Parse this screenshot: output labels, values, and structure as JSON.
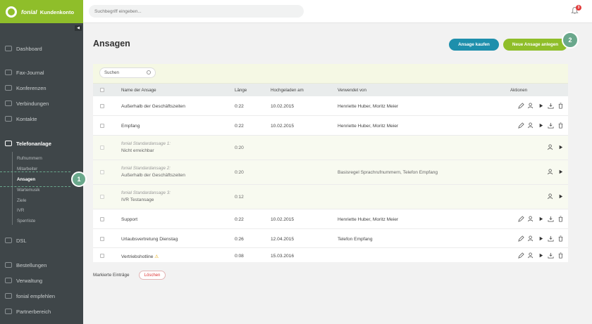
{
  "brand": {
    "name": "fonial",
    "suffix": "Kundenkonto"
  },
  "topbar": {
    "search_placeholder": "Suchbegriff eingeben...",
    "notifications_count": "3"
  },
  "sidebar": {
    "collapse_glyph": "◀",
    "items": [
      {
        "label": "Dashboard"
      },
      {
        "label": "Fax-Journal"
      },
      {
        "label": "Konferenzen"
      },
      {
        "label": "Verbindungen"
      },
      {
        "label": "Kontakte"
      },
      {
        "label": "Telefonanlage"
      },
      {
        "label": "DSL"
      },
      {
        "label": "Bestellungen"
      },
      {
        "label": "Verwaltung"
      },
      {
        "label": "fonial empfehlen"
      },
      {
        "label": "Partnerbereich"
      }
    ],
    "sub_items": [
      {
        "label": "Rufnummern"
      },
      {
        "label": "Mitarbeiter"
      },
      {
        "label": "Ansagen"
      },
      {
        "label": "Wartemusik"
      },
      {
        "label": "Ziele"
      },
      {
        "label": "IVR"
      },
      {
        "label": "Sperrliste"
      }
    ]
  },
  "main": {
    "title": "Ansagen",
    "buttons": {
      "buy": "Ansage kaufen",
      "new": "Neue Ansage anlegen"
    },
    "search_label": "Suchen",
    "columns": {
      "name": "Name der Ansage",
      "length": "Länge",
      "uploaded": "Hochgeladen am",
      "used_by": "Verwendet von",
      "actions": "Aktionen"
    },
    "rows": [
      {
        "prefix": "",
        "name": "Außerhalb der Geschäftszeiten",
        "length": "0:22",
        "uploaded": "10.02.2015",
        "used_by": "Henriette Huber, Moritz Meier"
      },
      {
        "prefix": "",
        "name": "Empfang",
        "length": "0:22",
        "uploaded": "10.02.2015",
        "used_by": "Henriette Huber, Moritz Meier"
      },
      {
        "prefix": "fonial Standardansage 1:",
        "name": "Nicht erreichbar",
        "length": "0:20",
        "uploaded": "",
        "used_by": ""
      },
      {
        "prefix": "fonial Standardansage 2:",
        "name": "Außerhalb der Geschäftszeiten",
        "length": "0:20",
        "uploaded": "",
        "used_by": "Basisregel Sprachrufnummern, Telefon Empfang"
      },
      {
        "prefix": "fonial Standardansage 3:",
        "name": "IVR Testansage",
        "length": "0:12",
        "uploaded": "",
        "used_by": ""
      },
      {
        "prefix": "",
        "name": "Support",
        "length": "0:22",
        "uploaded": "10.02.2015",
        "used_by": "Henriette Huber, Moritz Meier"
      },
      {
        "prefix": "",
        "name": "Urlaubsvertretung Dienstag",
        "length": "0:26",
        "uploaded": "12.04.2015",
        "used_by": "Telefon Empfang"
      },
      {
        "prefix": "",
        "name": "Vertriebshotline",
        "length": "0:08",
        "uploaded": "15.03.2016",
        "used_by": ""
      }
    ],
    "warning_glyph": "⚠",
    "bulk_label": "Markierte Einträge",
    "delete_label": "Löschen"
  },
  "annotations": {
    "one": "1",
    "two": "2"
  },
  "colors": {
    "brand_green": "#8fbe2a",
    "teal": "#1e8fac",
    "sidebar": "#3f4649",
    "annotation": "#6aa88c"
  }
}
